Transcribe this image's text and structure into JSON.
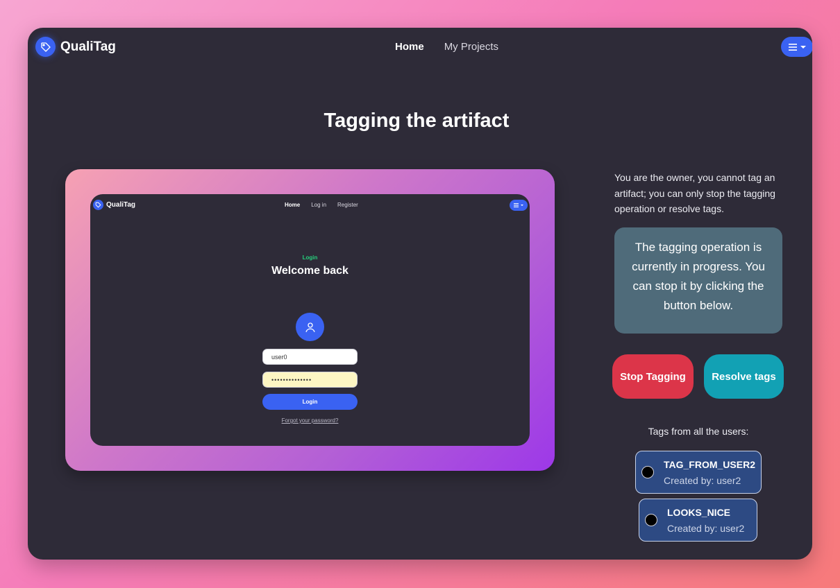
{
  "header": {
    "brand": "QualiTag",
    "nav": [
      {
        "label": "Home",
        "active": true
      },
      {
        "label": "My Projects",
        "active": false
      }
    ],
    "menu_icon": "hamburger-icon"
  },
  "main": {
    "title": "Tagging the artifact",
    "artifact_preview": {
      "brand": "QualiTag",
      "nav": [
        "Home",
        "Log in",
        "Register"
      ],
      "overline": "Login",
      "title": "Welcome back",
      "username_value": "user0",
      "password_value": "••••••••••••••",
      "login_button": "Login",
      "forgot_link": "Forgot your password?"
    },
    "sidebar": {
      "owner_note": "You are the owner, you cannot tag an artifact; you can only stop the tagging operation or resolve tags.",
      "status_message": "The tagging operation is currently in progress. You can stop it by clicking the button below.",
      "stop_button": "Stop Tagging",
      "resolve_button": "Resolve tags",
      "tags_heading": "Tags from all the users:",
      "tags": [
        {
          "name": "TAG_FROM_USER2",
          "created_by": "Created by: user2"
        },
        {
          "name": "LOOKS_NICE",
          "created_by": "Created by: user2"
        }
      ]
    }
  },
  "colors": {
    "accent": "#3a62f2",
    "background": "#2e2b38",
    "danger": "#dc3549",
    "info": "#12a1b4",
    "status_box": "#4f6b7a",
    "tag_card": "#2d4a83"
  }
}
